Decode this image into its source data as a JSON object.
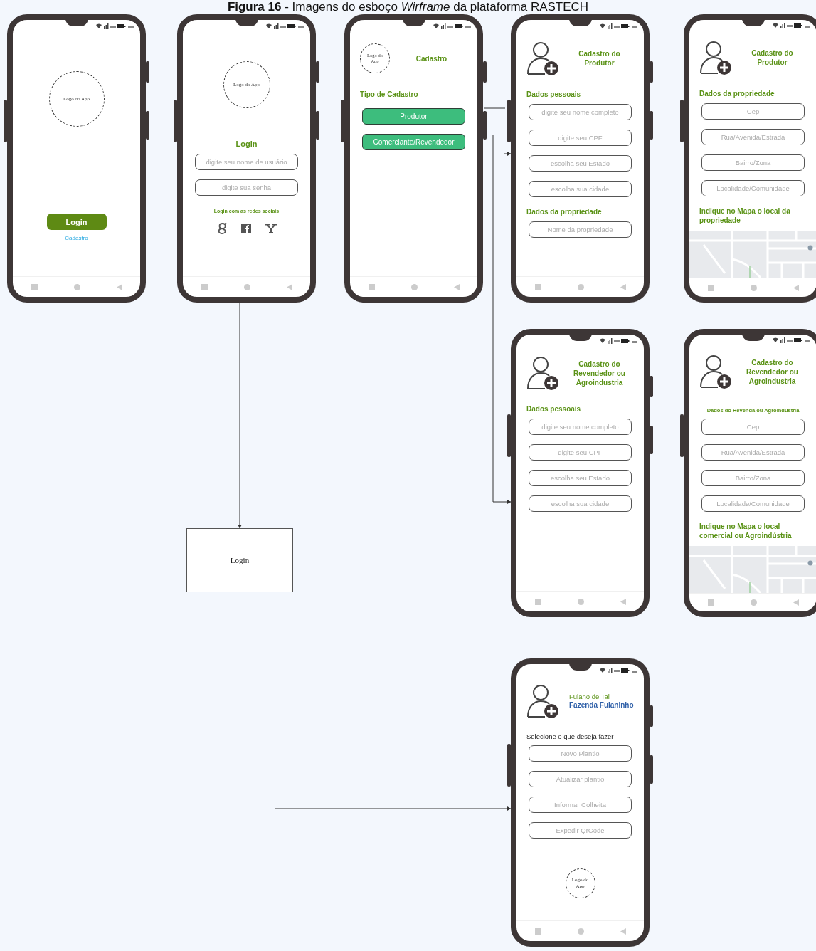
{
  "caption": "**Figura 16** - Imagens do esboço *Wirframe* da plataforma RASTECH",
  "screens": [
    {
      "items": [
        {
          "kind": "logo",
          "text": "Logo do App"
        },
        {
          "kind": "login_button",
          "label": "Login"
        },
        {
          "kind": "link",
          "text": "Cadastro"
        }
      ]
    },
    {
      "items": [
        {
          "kind": "logo",
          "text": "Logo do App"
        },
        {
          "kind": "title",
          "text": "Login"
        },
        {
          "kind": "field",
          "placeholder": "digite seu nome de usuário"
        },
        {
          "kind": "field",
          "placeholder": "digite sua senha"
        },
        {
          "kind": "caption",
          "text": "Login com as redes sociais"
        },
        {
          "kind": "social"
        }
      ]
    },
    {
      "items": [
        {
          "kind": "logo_header",
          "logo_text": "Logo do App",
          "title": "Cadastro"
        },
        {
          "kind": "heading",
          "text": "Tipo de Cadastro"
        },
        {
          "kind": "type_button",
          "label": "Produtor"
        },
        {
          "kind": "type_button",
          "label": "Comerciante/Revendedor"
        }
      ]
    },
    {
      "items": [
        {
          "kind": "avatar_header",
          "title": "Cadastro do Produtor"
        },
        {
          "kind": "heading",
          "text": "Dados pessoais"
        },
        {
          "kind": "field",
          "placeholder": "digite seu nome completo"
        },
        {
          "kind": "field",
          "placeholder": "digite seu CPF"
        },
        {
          "kind": "field",
          "placeholder": "escolha seu Estado"
        },
        {
          "kind": "field",
          "placeholder": "escolha sua cidade"
        },
        {
          "kind": "heading",
          "text": "Dados da propriedade"
        },
        {
          "kind": "field",
          "placeholder": "Nome da propriedade"
        }
      ]
    },
    {
      "items": [
        {
          "kind": "avatar_header",
          "title": "Cadastro do Produtor"
        },
        {
          "kind": "heading",
          "text": "Dados da propriedade"
        },
        {
          "kind": "field",
          "placeholder": "Cep"
        },
        {
          "kind": "field",
          "placeholder": "Rua/Avenida/Estrada"
        },
        {
          "kind": "field",
          "placeholder": "Bairro/Zona"
        },
        {
          "kind": "field",
          "placeholder": "Localidade/Comunidade"
        },
        {
          "kind": "heading",
          "text": "Indique no Mapa o local da propriedade"
        },
        {
          "kind": "map"
        }
      ]
    },
    {
      "items": [
        {
          "kind": "avatar_header",
          "title": "Cadastro do Revendedor ou Agroindustria"
        },
        {
          "kind": "heading",
          "text": "Dados pessoais"
        },
        {
          "kind": "field",
          "placeholder": "digite seu nome completo"
        },
        {
          "kind": "field",
          "placeholder": "digite seu CPF"
        },
        {
          "kind": "field",
          "placeholder": "escolha seu Estado"
        },
        {
          "kind": "field",
          "placeholder": "escolha sua cidade"
        }
      ]
    },
    {
      "items": [
        {
          "kind": "avatar_header",
          "title": "Cadastro do Revendedor ou Agroindustria"
        },
        {
          "kind": "subheading",
          "text": "Dados do Revenda ou Agroindustria"
        },
        {
          "kind": "field",
          "placeholder": "Cep"
        },
        {
          "kind": "field",
          "placeholder": "Rua/Avenida/Estrada"
        },
        {
          "kind": "field",
          "placeholder": "Bairro/Zona"
        },
        {
          "kind": "field",
          "placeholder": "Localidade/Comunidade"
        },
        {
          "kind": "heading",
          "text": "Indique no Mapa o local comercial ou Agroindústria"
        },
        {
          "kind": "map"
        }
      ]
    },
    {
      "items": [
        {
          "kind": "profile",
          "name": "Fulano de Tal",
          "farm": "Fazenda Fulaninho"
        },
        {
          "kind": "instruction",
          "text": "Selecione o que deseja fazer"
        },
        {
          "kind": "option",
          "label": "Novo Plantio"
        },
        {
          "kind": "option",
          "label": "Atualizar plantio"
        },
        {
          "kind": "option",
          "label": "Informar Colheita"
        },
        {
          "kind": "option",
          "label": "Expedir QrCode"
        },
        {
          "kind": "logo",
          "text": "Logo do App"
        }
      ]
    }
  ],
  "note_box": {
    "label": "Login"
  }
}
